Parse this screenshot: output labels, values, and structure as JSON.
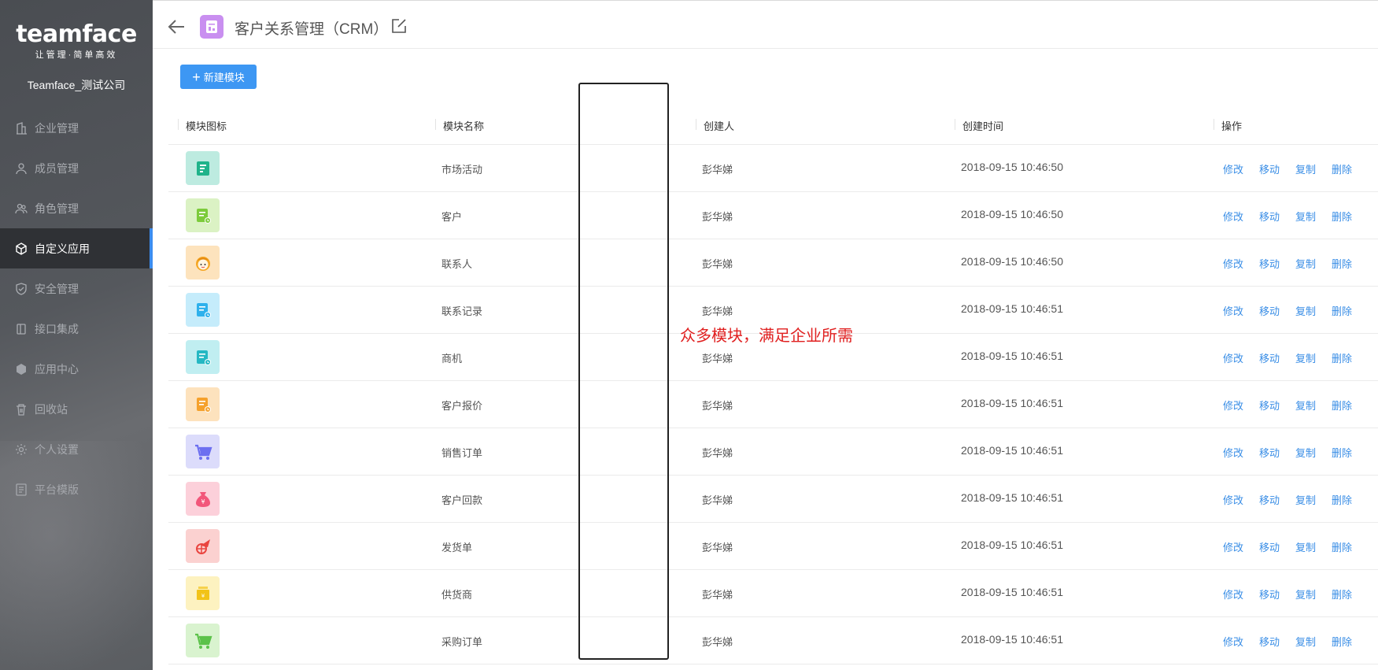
{
  "sidebar": {
    "logo_word": "teamface",
    "logo_tagline": "让管理·简单高效",
    "company": "Teamface_测试公司",
    "items": [
      {
        "label": "企业管理",
        "icon": "building-icon",
        "active": false
      },
      {
        "label": "成员管理",
        "icon": "user-icon",
        "active": false
      },
      {
        "label": "角色管理",
        "icon": "users-icon",
        "active": false
      },
      {
        "label": "自定义应用",
        "icon": "cube-icon",
        "active": true
      },
      {
        "label": "安全管理",
        "icon": "shield-icon",
        "active": false
      },
      {
        "label": "接口集成",
        "icon": "plug-icon",
        "active": false
      },
      {
        "label": "应用中心",
        "icon": "box-icon",
        "active": false
      },
      {
        "label": "回收站",
        "icon": "trash-icon",
        "active": false
      },
      {
        "label": "个人设置",
        "icon": "gear-icon",
        "active": false
      },
      {
        "label": "平台模版",
        "icon": "template-icon",
        "active": false
      }
    ]
  },
  "header": {
    "title": "客户关系管理（CRM）"
  },
  "toolbar": {
    "new_module_label": "新建模块"
  },
  "table": {
    "columns": [
      "模块图标",
      "模块名称",
      "创建人",
      "创建时间",
      "操作"
    ],
    "actions": [
      "修改",
      "移动",
      "复制",
      "删除"
    ],
    "rows": [
      {
        "name": "市场活动",
        "creator": "彭华娣",
        "time": "2018-09-15 10:46:50",
        "icon": "note-icon",
        "bg": "#bdebe0",
        "fg": "#1fb38a"
      },
      {
        "name": "客户",
        "creator": "彭华娣",
        "time": "2018-09-15 10:46:50",
        "icon": "contact-card-icon",
        "bg": "#dbf2c4",
        "fg": "#7ccb3b"
      },
      {
        "name": "联系人",
        "creator": "彭华娣",
        "time": "2018-09-15 10:46:50",
        "icon": "person-face-icon",
        "bg": "#fde3bd",
        "fg": "#f5a623"
      },
      {
        "name": "联系记录",
        "creator": "彭华娣",
        "time": "2018-09-15 10:46:51",
        "icon": "record-icon",
        "bg": "#c5ecfb",
        "fg": "#2fb1ec"
      },
      {
        "name": "商机",
        "creator": "彭华娣",
        "time": "2018-09-15 10:46:51",
        "icon": "opportunity-icon",
        "bg": "#c0eef1",
        "fg": "#25b8c3"
      },
      {
        "name": "客户报价",
        "creator": "彭华娣",
        "time": "2018-09-15 10:46:51",
        "icon": "quote-icon",
        "bg": "#fde2bd",
        "fg": "#f5a12c"
      },
      {
        "name": "销售订单",
        "creator": "彭华娣",
        "time": "2018-09-15 10:46:51",
        "icon": "cart-icon",
        "bg": "#dcdcfb",
        "fg": "#6c6ff0"
      },
      {
        "name": "客户回款",
        "creator": "彭华娣",
        "time": "2018-09-15 10:46:51",
        "icon": "money-bag-icon",
        "bg": "#fcd0da",
        "fg": "#f2567a"
      },
      {
        "name": "发货单",
        "creator": "彭华娣",
        "time": "2018-09-15 10:46:51",
        "icon": "plane-globe-icon",
        "bg": "#fbd1d0",
        "fg": "#e9443f"
      },
      {
        "name": "供货商",
        "creator": "彭华娣",
        "time": "2018-09-15 10:46:51",
        "icon": "supplier-box-icon",
        "bg": "#fdf2c0",
        "fg": "#f2c318"
      },
      {
        "name": "采购订单",
        "creator": "彭华娣",
        "time": "2018-09-15 10:46:51",
        "icon": "cart-icon",
        "bg": "#d9f3cf",
        "fg": "#5cc24a"
      }
    ]
  },
  "annotation": {
    "text": "众多模块，满足企业所需",
    "color": "#e02020"
  }
}
